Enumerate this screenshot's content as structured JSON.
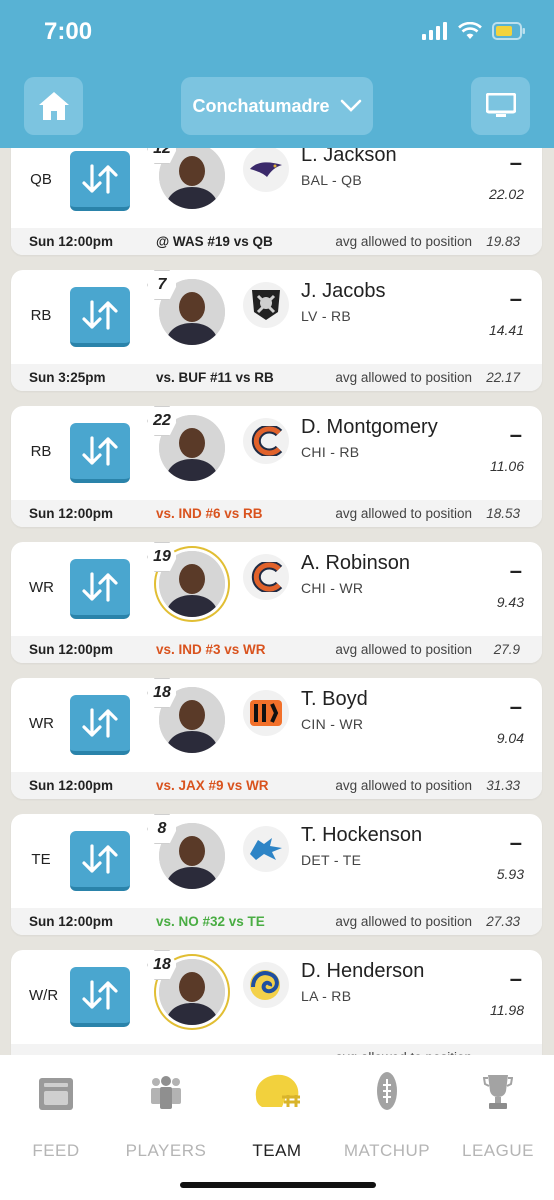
{
  "status": {
    "time": "7:00"
  },
  "header": {
    "team_name": "Conchatumadre"
  },
  "label_avg": "avg allowed to position",
  "roster": [
    {
      "position": "QB",
      "jersey": "12",
      "name": "L. Jackson",
      "team_pos": "BAL - QB",
      "projection": "–",
      "score": "22.02",
      "game_time": "Sun 12:00pm",
      "opponent": "@ WAS #19 vs QB",
      "opp_status": "neutral",
      "avg_allowed": "19.83",
      "team_logo": "ravens-logo-icon",
      "highlight": false
    },
    {
      "position": "RB",
      "jersey": "7",
      "name": "J. Jacobs",
      "team_pos": "LV - RB",
      "projection": "–",
      "score": "14.41",
      "game_time": "Sun 3:25pm",
      "opponent": "vs. BUF #11 vs RB",
      "opp_status": "neutral",
      "avg_allowed": "22.17",
      "team_logo": "raiders-logo-icon",
      "highlight": false
    },
    {
      "position": "RB",
      "jersey": "22",
      "name": "D. Montgomery",
      "team_pos": "CHI - RB",
      "projection": "–",
      "score": "11.06",
      "game_time": "Sun 12:00pm",
      "opponent": "vs. IND #6 vs RB",
      "opp_status": "bad",
      "avg_allowed": "18.53",
      "team_logo": "bears-logo-icon",
      "highlight": false
    },
    {
      "position": "WR",
      "jersey": "19",
      "name": "A. Robinson",
      "team_pos": "CHI - WR",
      "projection": "–",
      "score": "9.43",
      "game_time": "Sun 12:00pm",
      "opponent": "vs. IND #3 vs WR",
      "opp_status": "bad",
      "avg_allowed": "27.9",
      "team_logo": "bears-logo-icon",
      "highlight": true
    },
    {
      "position": "WR",
      "jersey": "18",
      "name": "T. Boyd",
      "team_pos": "CIN - WR",
      "projection": "–",
      "score": "9.04",
      "game_time": "Sun 12:00pm",
      "opponent": "vs. JAX #9 vs WR",
      "opp_status": "bad",
      "avg_allowed": "31.33",
      "team_logo": "bengals-logo-icon",
      "highlight": false
    },
    {
      "position": "TE",
      "jersey": "8",
      "name": "T. Hockenson",
      "team_pos": "DET - TE",
      "projection": "–",
      "score": "5.93",
      "game_time": "Sun 12:00pm",
      "opponent": "vs. NO #32 vs TE",
      "opp_status": "good",
      "avg_allowed": "27.33",
      "team_logo": "lions-logo-icon",
      "highlight": false
    },
    {
      "position": "W/R",
      "jersey": "18",
      "name": "D. Henderson",
      "team_pos": "LA - RB",
      "projection": "–",
      "score": "11.98",
      "game_time": "",
      "opponent": "",
      "opp_status": "good",
      "avg_allowed": "",
      "team_logo": "rams-logo-icon",
      "highlight": true
    }
  ],
  "tabs": [
    {
      "label": "FEED",
      "icon": "feed-icon",
      "active": false
    },
    {
      "label": "PLAYERS",
      "icon": "players-icon",
      "active": false
    },
    {
      "label": "TEAM",
      "icon": "helmet-icon",
      "active": true
    },
    {
      "label": "MATCHUP",
      "icon": "football-icon",
      "active": false
    },
    {
      "label": "LEAGUE",
      "icon": "trophy-icon",
      "active": false
    }
  ],
  "colors": {
    "header": "#58b2d4",
    "swap_button": "#4aa6cf",
    "bad": "#d9531e",
    "good": "#4aad43",
    "highlight_ring": "#e1be33"
  }
}
